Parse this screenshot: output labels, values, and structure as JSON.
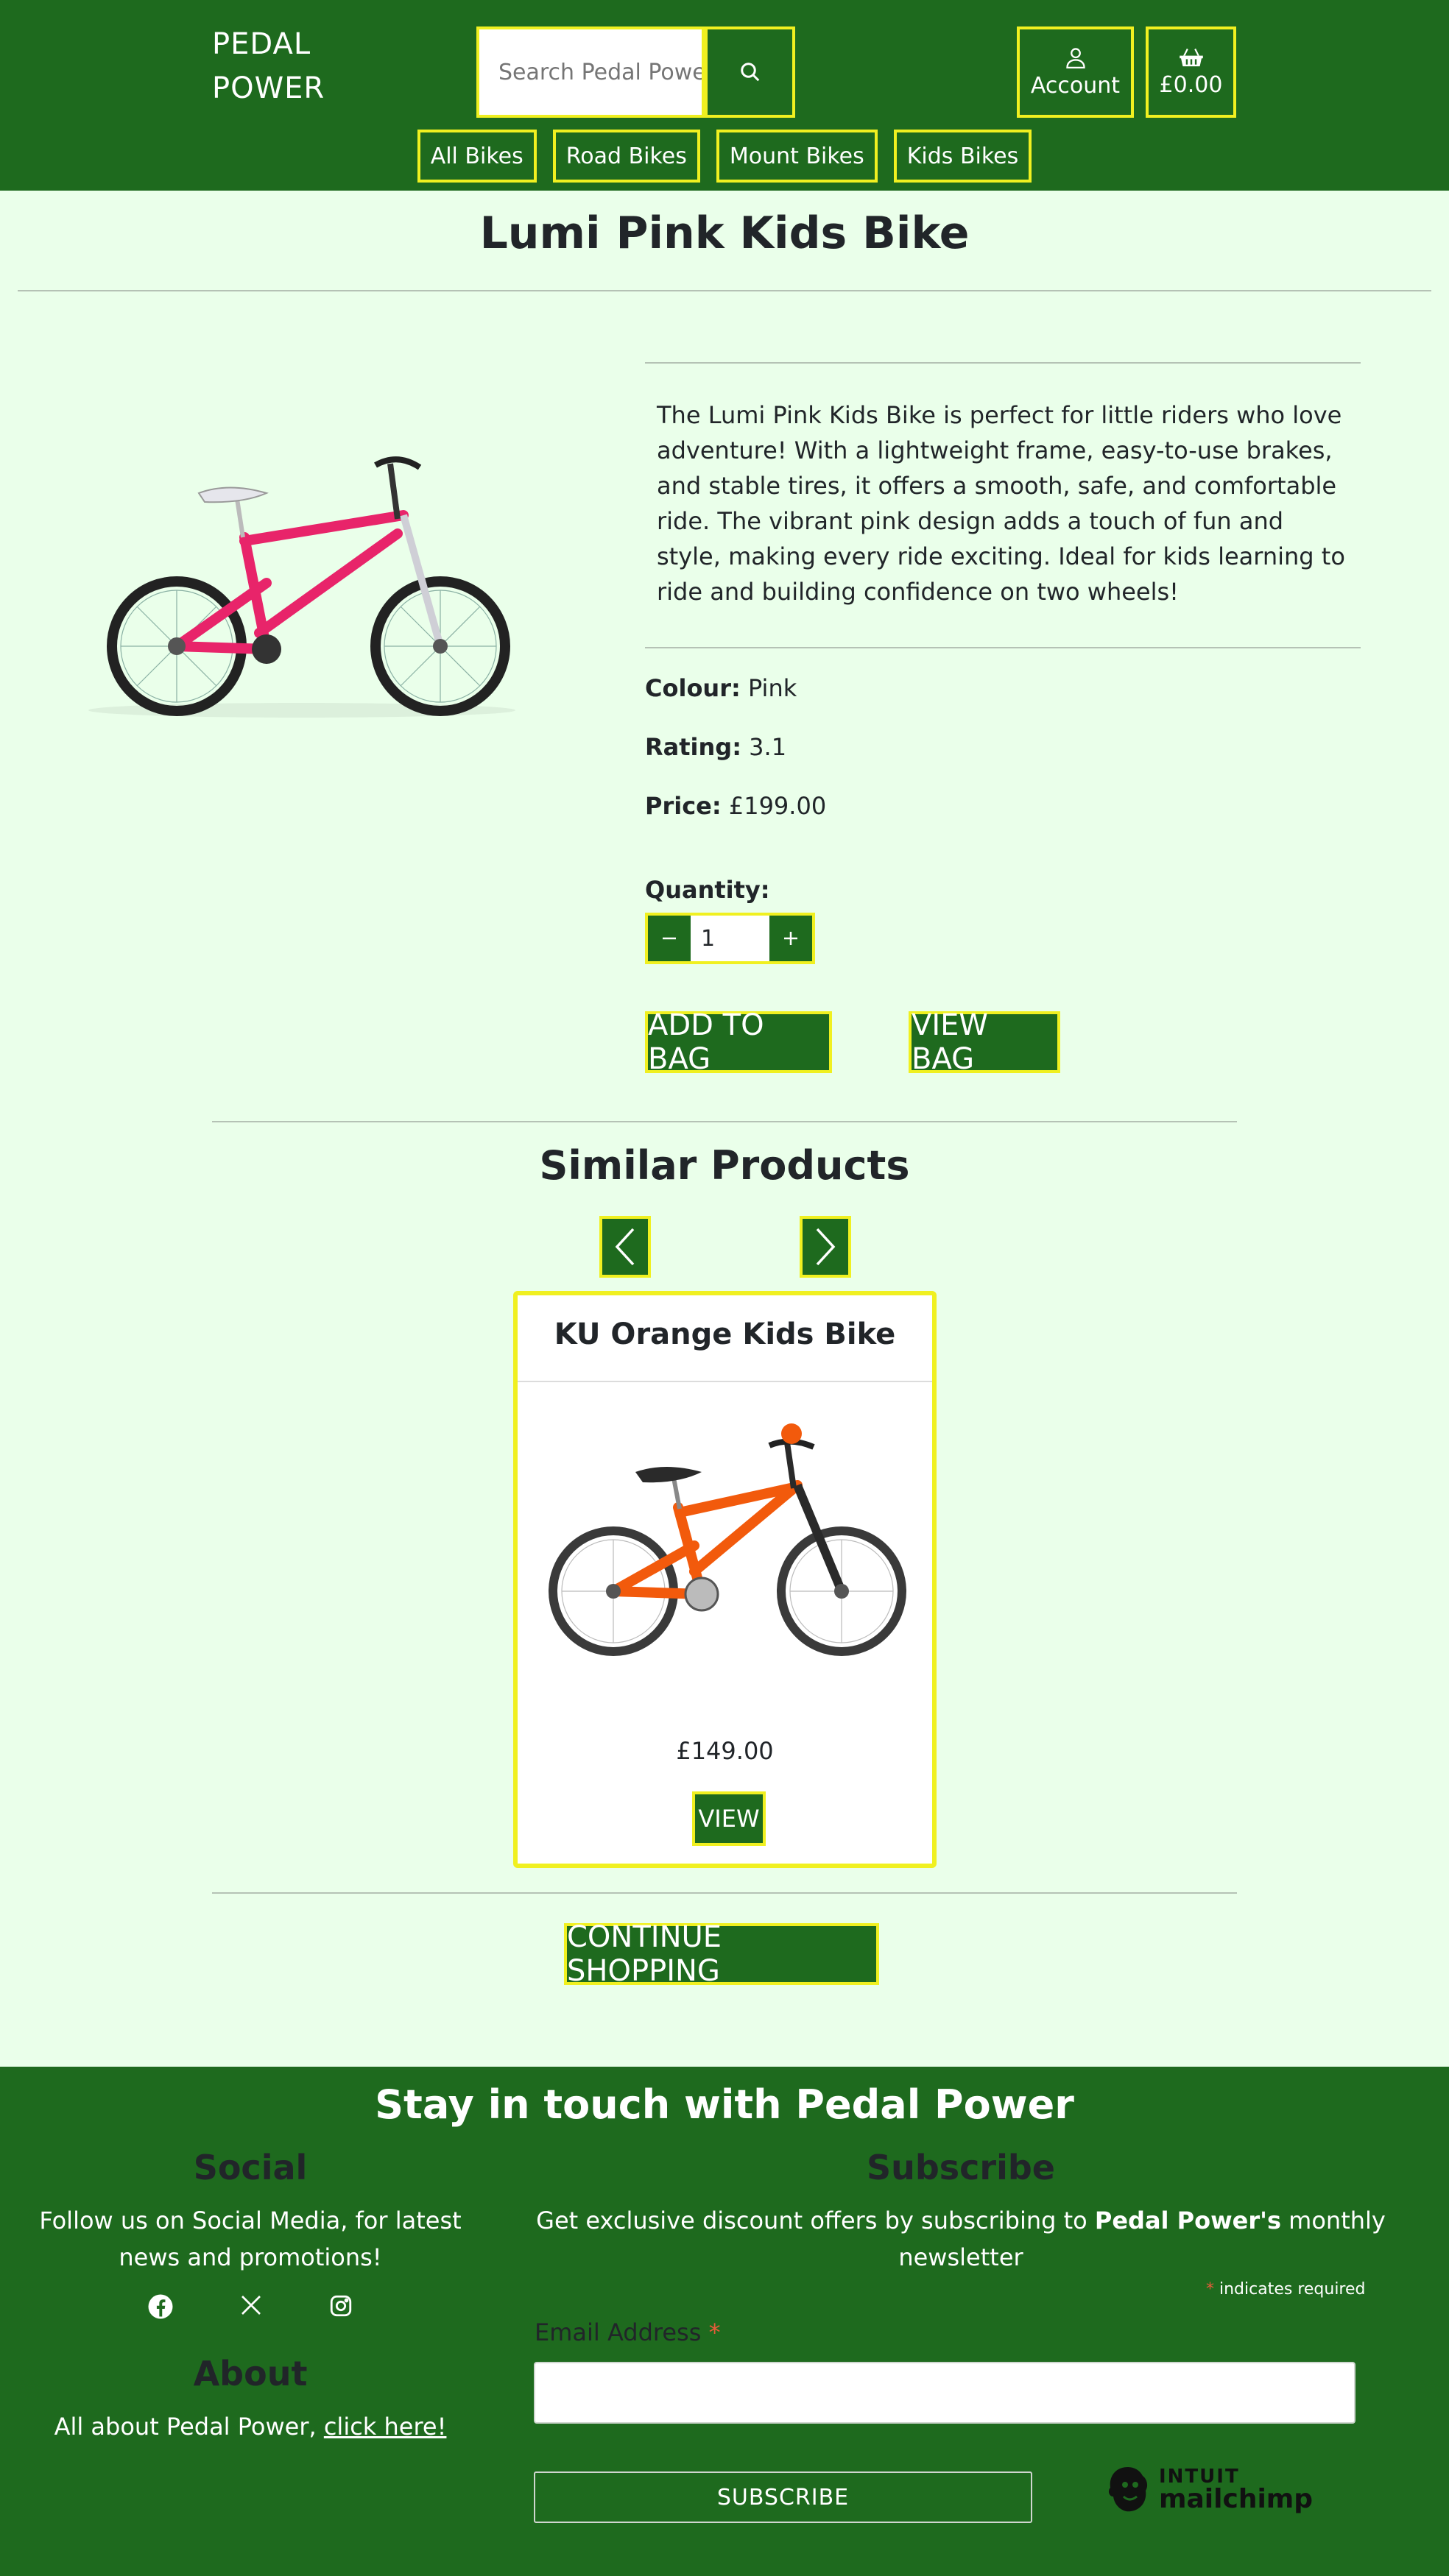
{
  "header": {
    "brand_line1": "PEDAL",
    "brand_line2": "POWER",
    "search_placeholder": "Search Pedal Power",
    "account_label": "Account",
    "bag_total": "£0.00",
    "nav": [
      "All Bikes",
      "Road Bikes",
      "Mount Bikes",
      "Kids Bikes"
    ]
  },
  "product": {
    "title": "Lumi Pink Kids Bike",
    "description": "The Lumi Pink Kids Bike is perfect for little riders who love adventure! With a lightweight frame, easy-to-use brakes, and stable tires, it offers a smooth, safe, and comfortable ride. The vibrant pink design adds a touch of fun and style, making every ride exciting. Ideal for kids learning to ride and building confidence on two wheels!",
    "colour_label": "Colour:",
    "colour": "Pink",
    "rating_label": "Rating:",
    "rating": "3.1",
    "price_label": "Price:",
    "price": "£199.00",
    "quantity_label": "Quantity:",
    "quantity": "1",
    "add_to_bag": "ADD TO BAG",
    "view_bag": "VIEW BAG",
    "frame_color": "#e8246a"
  },
  "similar": {
    "title": "Similar Products",
    "card": {
      "name": "KU Orange Kids Bike",
      "price": "£149.00",
      "view": "VIEW",
      "frame_color": "#f25a0c"
    },
    "continue": "CONTINUE SHOPPING"
  },
  "footer": {
    "title": "Stay in touch with Pedal Power",
    "social_heading": "Social",
    "social_text_1": "Follow us on Social Media, for latest",
    "social_text_2": "news and promotions!",
    "social_icons": [
      "facebook-icon",
      "x-icon",
      "instagram-icon"
    ],
    "about_heading": "About",
    "about_text": "All about Pedal Power, ",
    "about_link": "click here!",
    "subscribe_heading": "Subscribe",
    "subscribe_text_before": "Get exclusive discount offers by subscribing to ",
    "subscribe_text_bold": "Pedal Power's",
    "subscribe_text_after": " monthly newsletter",
    "required_note": " indicates required",
    "required_star": "*",
    "email_label": "Email Address ",
    "subscribe_button": "SUBSCRIBE",
    "mailchimp_intuit": "INTUIT",
    "mailchimp_name": "mailchimp"
  },
  "colors": {
    "brand_green": "#1e6a1e",
    "accent_yellow": "#f0f020",
    "page_bg": "#eaffea"
  }
}
